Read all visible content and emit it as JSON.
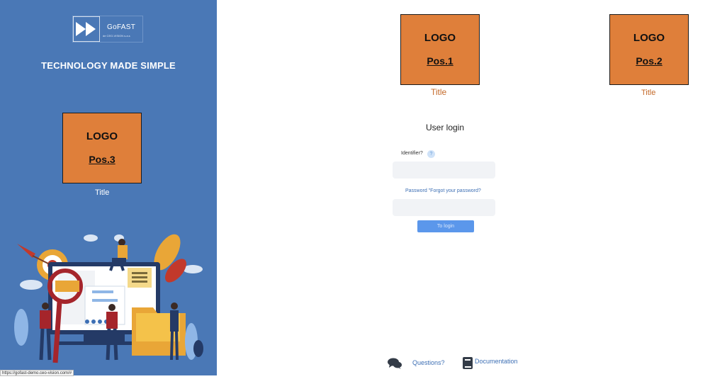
{
  "colors": {
    "panel_bg": "#4a78b6",
    "logo_placeholder": "#df7f3a",
    "title_text": "#c46a2a",
    "link": "#3d6fb4",
    "button": "#5b97eb"
  },
  "brand": {
    "name": "GoFAST",
    "subtitle": "de CEO-VISION s.a.s",
    "icon": "fast-forward-icon"
  },
  "tagline": "TECHNOLOGY MADE SIMPLE",
  "logos": {
    "pos1": {
      "line1": "LOGO",
      "line2": "Pos.1",
      "title": "Title"
    },
    "pos2": {
      "line1": "LOGO",
      "line2": "Pos.2",
      "title": "Title"
    },
    "pos3": {
      "line1": "LOGO",
      "line2": "Pos.3",
      "title": "Title"
    }
  },
  "login": {
    "heading": "User login",
    "identifier_label": "Identifier?",
    "help_icon": "question-icon",
    "password_label": "Password \"Forgot your password?",
    "submit_label": "To login"
  },
  "footer": {
    "questions_label": "Questions?",
    "questions_icon": "chat-bubbles-icon",
    "documentation_label": "Documentation",
    "documentation_icon": "book-icon"
  },
  "status_bar": {
    "url": "https://gofast-demo.ceo-vision.com/#"
  }
}
